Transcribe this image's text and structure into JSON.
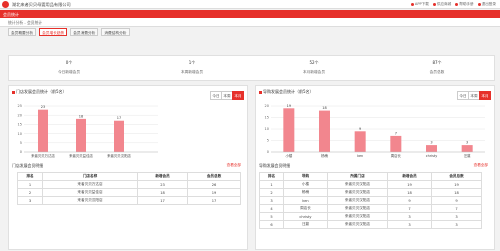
{
  "header": {
    "company": "湖北来者贝贝母婴用品有限公司",
    "links": [
      "APP下载",
      "供应商城",
      "帮助手册",
      "退出登录"
    ]
  },
  "nav": {
    "title": "会员统计"
  },
  "breadcrumb": "统计分析 - 会员统计",
  "tabs": [
    {
      "label": "会员概要分析",
      "active": false
    },
    {
      "label": "会员增长趋势",
      "active": true
    },
    {
      "label": "会员消费分析",
      "active": false
    },
    {
      "label": "消费结构分析",
      "active": false
    }
  ],
  "stats": [
    {
      "value": "0个",
      "label": "今日新增会员"
    },
    {
      "value": "1个",
      "label": "本周新增会员"
    },
    {
      "value": "52个",
      "label": "本月新增会员"
    },
    {
      "value": "87个",
      "label": "会员总数"
    }
  ],
  "left_panel": {
    "title": "门店发展会员统计（前5名）",
    "buttons": [
      "今日",
      "本周",
      "本月"
    ],
    "active_button": "本月",
    "section_title": "门店发展会员明细",
    "section_link": "查看全部",
    "columns": [
      "排名",
      "门店名称",
      "新增会员",
      "会员总数"
    ],
    "rows": [
      [
        "1",
        "来者贝贝万达店",
        "23",
        "26"
      ],
      [
        "2",
        "来者贝贝益佳店",
        "18",
        "19"
      ],
      [
        "3",
        "来者贝贝汉阳店",
        "17",
        "17"
      ]
    ]
  },
  "right_panel": {
    "title": "导购发展会员统计（前5名）",
    "buttons": [
      "今日",
      "本周",
      "本月"
    ],
    "active_button": "本月",
    "section_title": "导购发展会员明细",
    "section_link": "查看全部",
    "columns": [
      "排名",
      "导购",
      "所属门店",
      "新增会员",
      "会员总数"
    ],
    "rows": [
      [
        "1",
        "小楼",
        "来者贝贝汉阳店",
        "19",
        "19"
      ],
      [
        "2",
        "杨稍",
        "来者贝贝汉阳店",
        "18",
        "18"
      ],
      [
        "3",
        "ken",
        "来者贝贝汉阳店",
        "9",
        "9"
      ],
      [
        "4",
        "周店长",
        "来者贝贝汉阳店",
        "7",
        "7"
      ],
      [
        "5",
        "christy",
        "来者贝贝汉阳店",
        "3",
        "3"
      ],
      [
        "6",
        "汪蔓",
        "来者贝贝汉阳店",
        "3",
        "3"
      ]
    ]
  },
  "colors": {
    "accent": "#e6302a",
    "bar": "#f2868e"
  },
  "chart_data": [
    {
      "type": "bar",
      "title": "门店发展会员统计（前5名）",
      "categories": [
        "来者贝贝万达店",
        "来者贝贝益佳店",
        "来者贝贝汉阳店"
      ],
      "values": [
        23,
        18,
        17
      ],
      "ylim": [
        0,
        25
      ],
      "yticks": [
        0,
        5,
        10,
        15,
        20,
        25
      ]
    },
    {
      "type": "bar",
      "title": "导购发展会员统计（前5名）",
      "categories": [
        "小楼",
        "杨稍",
        "ken",
        "周店长",
        "christy",
        "汪蔓"
      ],
      "values": [
        19,
        18,
        9,
        7,
        3,
        3
      ],
      "ylim": [
        0,
        20
      ],
      "yticks": [
        0,
        5,
        10,
        15,
        20
      ]
    }
  ]
}
